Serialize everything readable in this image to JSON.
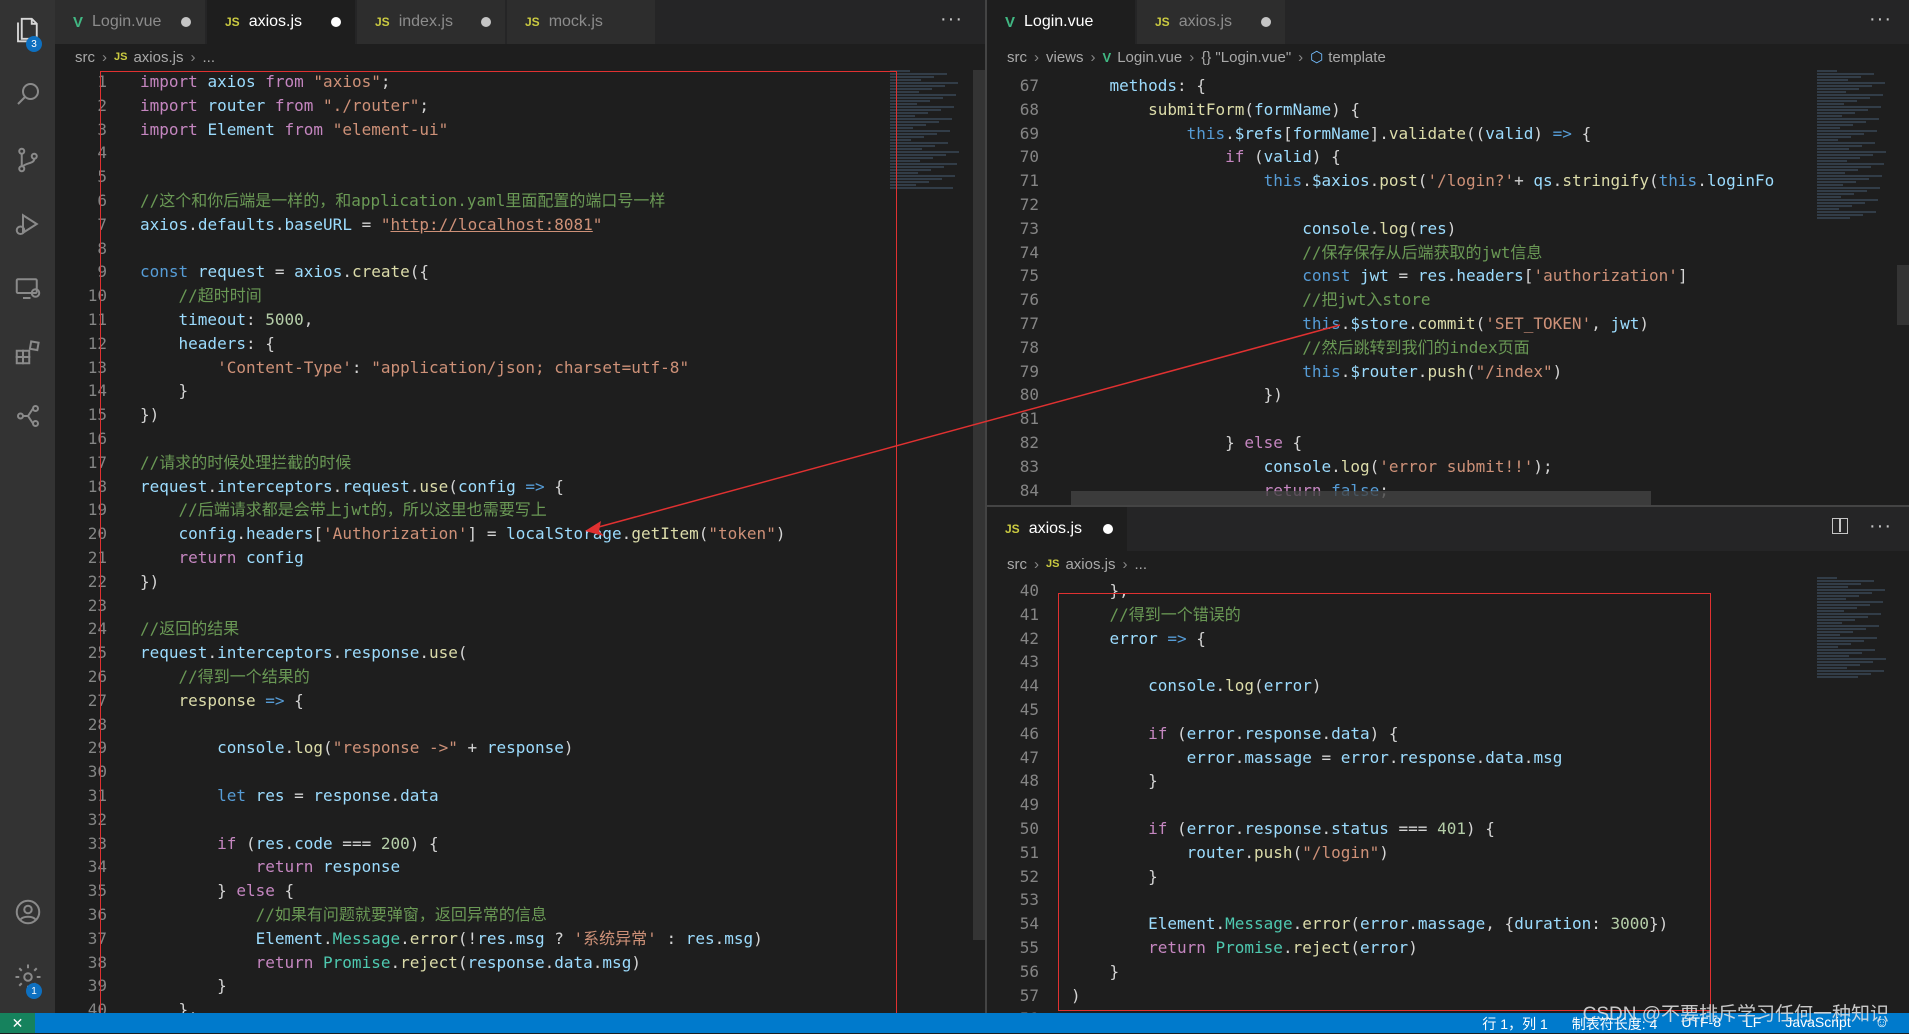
{
  "activity_bar": {
    "explorer_badge": "3",
    "settings_badge": "1",
    "icons": [
      "files-icon",
      "search-icon",
      "source-control-icon",
      "run-debug-icon",
      "remote-explorer-icon",
      "extensions-icon",
      "git-graph-icon",
      "account-icon",
      "settings-gear-icon"
    ]
  },
  "left_pane": {
    "tabs": [
      {
        "label": "Login.vue",
        "type": "vue"
      },
      {
        "label": "axios.js",
        "type": "js",
        "active": true
      },
      {
        "label": "index.js",
        "type": "js"
      },
      {
        "label": "mock.js",
        "type": "js"
      }
    ],
    "more": "···",
    "breadcrumb": [
      "src",
      "axios.js",
      "..."
    ],
    "lines": [
      {
        "n": "1",
        "code": "<span class='kw'>import</span> <span class='var'>axios</span> <span class='kw'>from</span> <span class='str'>\"axios\"</span>;"
      },
      {
        "n": "2",
        "code": "<span class='kw'>import</span> <span class='var'>router</span> <span class='kw'>from</span> <span class='str'>\"./router\"</span>;"
      },
      {
        "n": "3",
        "code": "<span class='kw'>import</span> <span class='var'>Element</span> <span class='kw'>from</span> <span class='str'>\"element-ui\"</span>"
      },
      {
        "n": "4",
        "code": ""
      },
      {
        "n": "5",
        "code": ""
      },
      {
        "n": "6",
        "code": "<span class='com'>//这个和你后端是一样的，和application.yaml里面配置的端口号一样</span>"
      },
      {
        "n": "7",
        "code": "<span class='var'>axios</span>.<span class='var'>defaults</span>.<span class='var'>baseURL</span> = <span class='str'>\"</span><span class='url'>http://localhost:8081</span><span class='str'>\"</span>"
      },
      {
        "n": "8",
        "code": ""
      },
      {
        "n": "9",
        "code": "<span class='kw2'>const</span> <span class='var'>request</span> = <span class='var'>axios</span>.<span class='fn'>create</span>({"
      },
      {
        "n": "10",
        "code": "    <span class='com'>//超时时间</span>"
      },
      {
        "n": "11",
        "code": "    <span class='var'>timeout</span>: <span class='num'>5000</span>,"
      },
      {
        "n": "12",
        "code": "    <span class='var'>headers</span>: {"
      },
      {
        "n": "13",
        "code": "        <span class='str'>'Content-Type'</span>: <span class='str'>\"application/json; charset=utf-8\"</span>"
      },
      {
        "n": "14",
        "code": "    }"
      },
      {
        "n": "15",
        "code": "})"
      },
      {
        "n": "16",
        "code": ""
      },
      {
        "n": "17",
        "code": "<span class='com'>//请求的时候处理拦截的时候</span>"
      },
      {
        "n": "18",
        "code": "<span class='var'>request</span>.<span class='var'>interceptors</span>.<span class='var'>request</span>.<span class='fn'>use</span>(<span class='var'>config</span> <span class='kw2'>=&gt;</span> {"
      },
      {
        "n": "19",
        "code": "    <span class='com'>//后端请求都是会带上jwt的，所以这里也需要写上</span>"
      },
      {
        "n": "20",
        "code": "    <span class='var'>config</span>.<span class='var'>headers</span>[<span class='str'>'Authorization'</span>] = <span class='var'>localStorage</span>.<span class='fn'>getItem</span>(<span class='str'>\"token\"</span>)"
      },
      {
        "n": "21",
        "code": "    <span class='kw'>return</span> <span class='var'>config</span>"
      },
      {
        "n": "22",
        "code": "})"
      },
      {
        "n": "23",
        "code": ""
      },
      {
        "n": "24",
        "code": "<span class='com'>//返回的结果</span>"
      },
      {
        "n": "25",
        "code": "<span class='var'>request</span>.<span class='var'>interceptors</span>.<span class='var'>response</span>.<span class='fn'>use</span>("
      },
      {
        "n": "26",
        "code": "    <span class='com'>//得到一个结果的</span>"
      },
      {
        "n": "27",
        "code": "    <span class='fn'>response</span> <span class='kw2'>=&gt;</span> {"
      },
      {
        "n": "28",
        "code": ""
      },
      {
        "n": "29",
        "code": "        <span class='var'>console</span>.<span class='fn'>log</span>(<span class='str'>\"response -&gt;\"</span> + <span class='var'>response</span>)"
      },
      {
        "n": "30",
        "code": ""
      },
      {
        "n": "31",
        "code": "        <span class='kw2'>let</span> <span class='var'>res</span> = <span class='var'>response</span>.<span class='var'>data</span>"
      },
      {
        "n": "32",
        "code": ""
      },
      {
        "n": "33",
        "code": "        <span class='kw'>if</span> (<span class='var'>res</span>.<span class='var'>code</span> === <span class='num'>200</span>) {"
      },
      {
        "n": "34",
        "code": "            <span class='kw'>return</span> <span class='var'>response</span>"
      },
      {
        "n": "35",
        "code": "        } <span class='kw'>else</span> {"
      },
      {
        "n": "36",
        "code": "            <span class='com'>//如果有问题就要弹窗，返回异常的信息</span>"
      },
      {
        "n": "37",
        "code": "            <span class='var'>Element</span>.<span class='cls'>Message</span>.<span class='fn'>error</span>(!<span class='var'>res</span>.<span class='var'>msg</span> ? <span class='str'>'系统异常'</span> : <span class='var'>res</span>.<span class='var'>msg</span>)"
      },
      {
        "n": "38",
        "code": "            <span class='kw'>return</span> <span class='cls'>Promise</span>.<span class='fn'>reject</span>(<span class='var'>response</span>.<span class='var'>data</span>.<span class='var'>msg</span>)"
      },
      {
        "n": "39",
        "code": "        }"
      },
      {
        "n": "40",
        "code": "    },"
      }
    ]
  },
  "right_top_pane": {
    "tabs": [
      {
        "label": "Login.vue",
        "type": "vue",
        "active": true
      },
      {
        "label": "axios.js",
        "type": "js"
      }
    ],
    "more": "···",
    "breadcrumb": [
      "src",
      "views",
      "Login.vue",
      "{} \"Login.vue\"",
      "template"
    ],
    "lines": [
      {
        "n": "67",
        "code": "    <span class='var'>methods</span>: {"
      },
      {
        "n": "68",
        "code": "        <span class='fn'>submitForm</span>(<span class='var'>formName</span>) {"
      },
      {
        "n": "69",
        "code": "            <span class='kw2'>this</span>.<span class='var'>$refs</span>[<span class='var'>formName</span>].<span class='fn'>validate</span>((<span class='var'>valid</span>) <span class='kw2'>=&gt;</span> {"
      },
      {
        "n": "70",
        "code": "                <span class='kw'>if</span> (<span class='var'>valid</span>) {"
      },
      {
        "n": "71",
        "code": "                    <span class='kw2'>this</span>.<span class='var'>$axios</span>.<span class='fn'>post</span>(<span class='str'>'/login?'</span>+ <span class='var'>qs</span>.<span class='fn'>stringify</span>(<span class='kw2'>this</span>.<span class='var'>loginFo</span>"
      },
      {
        "n": "72",
        "code": ""
      },
      {
        "n": "73",
        "code": "                        <span class='var'>console</span>.<span class='fn'>log</span>(<span class='var'>res</span>)"
      },
      {
        "n": "74",
        "code": "                        <span class='com'>//保存保存从后端获取的jwt信息</span>"
      },
      {
        "n": "75",
        "code": "                        <span class='kw2'>const</span> <span class='var'>jwt</span> = <span class='var'>res</span>.<span class='var'>headers</span>[<span class='str'>'authorization'</span>]"
      },
      {
        "n": "76",
        "code": "                        <span class='com'>//把jwt入store</span>"
      },
      {
        "n": "77",
        "code": "                        <span class='kw2'>this</span>.<span class='var'>$store</span>.<span class='fn'>commit</span>(<span class='str'>'SET_TOKEN'</span>, <span class='var'>jwt</span>)"
      },
      {
        "n": "78",
        "code": "                        <span class='com'>//然后跳转到我们的index页面</span>"
      },
      {
        "n": "79",
        "code": "                        <span class='kw2'>this</span>.<span class='var'>$router</span>.<span class='fn'>push</span>(<span class='str'>\"/index\"</span>)"
      },
      {
        "n": "80",
        "code": "                    })"
      },
      {
        "n": "81",
        "code": ""
      },
      {
        "n": "82",
        "code": "                } <span class='kw'>else</span> {"
      },
      {
        "n": "83",
        "code": "                    <span class='var'>console</span>.<span class='fn'>log</span>(<span class='str'>'error submit!!'</span>);"
      },
      {
        "n": "84",
        "code": "                    <span class='kw'>return</span> <span class='kw2'>false</span>;"
      }
    ]
  },
  "right_bottom_pane": {
    "tabs": [
      {
        "label": "axios.js",
        "type": "js",
        "active": true
      }
    ],
    "more": "···",
    "breadcrumb": [
      "src",
      "axios.js",
      "..."
    ],
    "lines": [
      {
        "n": "40",
        "code": "    },"
      },
      {
        "n": "41",
        "code": "    <span class='com'>//得到一个错误的</span>"
      },
      {
        "n": "42",
        "code": "    <span class='var'>error</span> <span class='kw2'>=&gt;</span> {"
      },
      {
        "n": "43",
        "code": ""
      },
      {
        "n": "44",
        "code": "        <span class='var'>console</span>.<span class='fn'>log</span>(<span class='var'>error</span>)"
      },
      {
        "n": "45",
        "code": ""
      },
      {
        "n": "46",
        "code": "        <span class='kw'>if</span> (<span class='var'>error</span>.<span class='var'>response</span>.<span class='var'>data</span>) {"
      },
      {
        "n": "47",
        "code": "            <span class='var'>error</span>.<span class='var'>massage</span> = <span class='var'>error</span>.<span class='var'>response</span>.<span class='var'>data</span>.<span class='var'>msg</span>"
      },
      {
        "n": "48",
        "code": "        }"
      },
      {
        "n": "49",
        "code": ""
      },
      {
        "n": "50",
        "code": "        <span class='kw'>if</span> (<span class='var'>error</span>.<span class='var'>response</span>.<span class='var'>status</span> === <span class='num'>401</span>) {"
      },
      {
        "n": "51",
        "code": "            <span class='var'>router</span>.<span class='fn'>push</span>(<span class='str'>\"/login\"</span>)"
      },
      {
        "n": "52",
        "code": "        }"
      },
      {
        "n": "53",
        "code": ""
      },
      {
        "n": "54",
        "code": "        <span class='var'>Element</span>.<span class='cls'>Message</span>.<span class='fn'>error</span>(<span class='var'>error</span>.<span class='var'>massage</span>, {<span class='var'>duration</span>: <span class='num'>3000</span>})"
      },
      {
        "n": "55",
        "code": "        <span class='kw'>return</span> <span class='cls'>Promise</span>.<span class='fn'>reject</span>(<span class='var'>error</span>)"
      },
      {
        "n": "56",
        "code": "    }"
      },
      {
        "n": "57",
        "code": ")"
      },
      {
        "n": "58",
        "code": ""
      }
    ]
  },
  "statusbar": {
    "position": "行 1，列 1",
    "indent": "制表符长度: 4",
    "encoding": "UTF-8",
    "eol": "LF",
    "language": "JavaScript"
  },
  "watermark": "CSDN @不要排斥学习任何一种知识",
  "colors": {
    "accent": "#007acc",
    "annotation": "#e03131",
    "vue": "#41b883",
    "js": "#cbcb41"
  }
}
